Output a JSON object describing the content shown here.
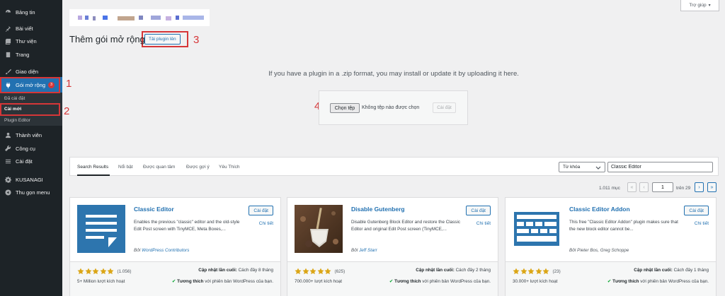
{
  "sidebar": {
    "items": [
      {
        "label": "Bảng tin",
        "icon": "dashboard-icon"
      },
      {
        "label": "Bài viết",
        "icon": "pin-icon"
      },
      {
        "label": "Thư viện",
        "icon": "media-icon"
      },
      {
        "label": "Trang",
        "icon": "page-icon"
      },
      {
        "label": "Giao diện",
        "icon": "brush-icon"
      },
      {
        "label": "Gói mở rộng",
        "icon": "plugin-icon",
        "badge": "3"
      },
      {
        "label": "Thành viên",
        "icon": "user-icon"
      },
      {
        "label": "Công cụ",
        "icon": "wrench-icon"
      },
      {
        "label": "Cài đặt",
        "icon": "settings-icon"
      },
      {
        "label": "KUSANAGI",
        "icon": "gear-icon"
      },
      {
        "label": "Thu gọn menu",
        "icon": "collapse-icon"
      }
    ],
    "submenu": [
      "Đã cài đặt",
      "Cài mới",
      "Plugin Editor"
    ]
  },
  "annotations": [
    "1",
    "2",
    "3",
    "4"
  ],
  "help": "Trợ giúp",
  "title": "Thêm gói mở rộng",
  "upload_button": "Tải plugin lên",
  "upload": {
    "hint": "If you have a plugin in a .zip format, you may install or update it by uploading it here.",
    "choose": "Chọn tệp",
    "no_file": "Không tệp nào được chọn",
    "install": "Cài đặt"
  },
  "filter": {
    "tabs": [
      "Search Results",
      "Nổi bật",
      "Được quan tâm",
      "Được gợi ý",
      "Yêu Thích"
    ],
    "select": "Từ khóa",
    "search_value": "Classic Editor"
  },
  "pagination": {
    "count": "1.011 mục",
    "first": "«",
    "prev": "‹",
    "page": "1",
    "of": "trên 29",
    "next": "›",
    "last": "»"
  },
  "plugins": [
    {
      "name": "Classic Editor",
      "install": "Cài đặt",
      "details": "Chi tiết",
      "desc": "Enables the previous \"classic\" editor and the old-style Edit Post screen with TinyMCE, Meta Boxes,...",
      "by": "Bởi",
      "author": "WordPress Contributors",
      "rating": 5,
      "ratings": "(1.056)",
      "installs": "5+ Million lượt kích hoạt",
      "updated_label": "Cập nhật lần cuối:",
      "updated": "Cách đây 8 tháng",
      "compat_label": "Tương thích",
      "compat": "với phiên bản WordPress của bạn."
    },
    {
      "name": "Disable Gutenberg",
      "install": "Cài đặt",
      "details": "Chi tiết",
      "desc": "Disable Gutenberg Block Editor and restore the Classic Editor and original Edit Post screen (TinyMCE,...",
      "by": "Bởi",
      "author": "Jeff Starr",
      "rating": 5,
      "ratings": "(625)",
      "installs": "700.000+ lượt kích hoạt",
      "updated_label": "Cập nhật lần cuối:",
      "updated": "Cách đây 2 tháng",
      "compat_label": "Tương thích",
      "compat": "với phiên bản WordPress của bạn."
    },
    {
      "name": "Classic Editor Addon",
      "install": "Cài đặt",
      "details": "Chi tiết",
      "desc": "This free \"Classic Editor Addon\" plugin makes sure that the new block editor cannot be...",
      "by": "Bởi",
      "author": "Pieter Bos, Greg Schoppe",
      "rating": 5,
      "ratings": "(23)",
      "installs": "30.000+ lượt kích hoạt",
      "updated_label": "Cập nhật lần cuối:",
      "updated": "Cách đây 1 tháng",
      "compat_label": "Tương thích",
      "compat": "với phiên bản WordPress của bạn."
    }
  ],
  "colors": {
    "sidebar": "#1d2327",
    "accent": "#2271b1",
    "highlight": "#d63638",
    "star": "#dba617"
  }
}
